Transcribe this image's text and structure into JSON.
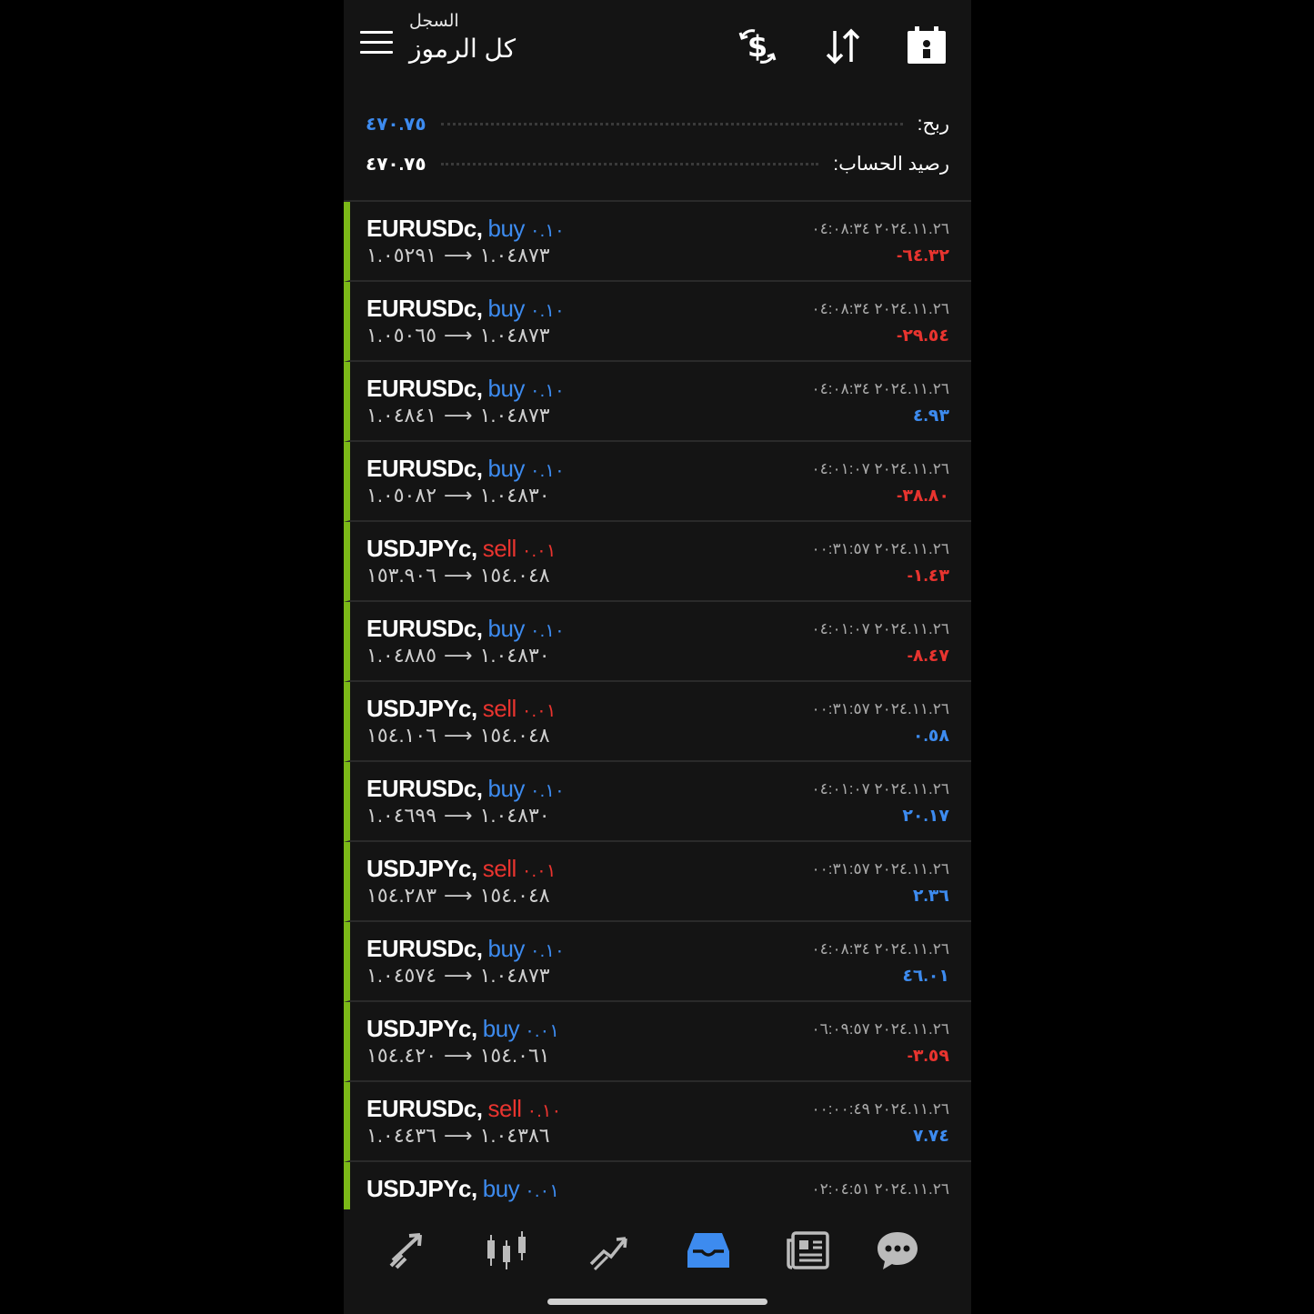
{
  "header": {
    "subtitle": "السجل",
    "title": "كل الرموز",
    "icons": [
      "menu-icon",
      "dollar-swap-icon",
      "sort-icon",
      "report-calendar-icon"
    ]
  },
  "summary": {
    "profit_label": "ربح:",
    "profit_value": "٤٧٠.٧٥",
    "balance_label": "رصيد الحساب:",
    "balance_value": "٤٧٠.٧٥"
  },
  "trades": [
    {
      "symbol": "EURUSDc,",
      "side": "buy",
      "volume": "٠.١٠",
      "open": "١.٠٤٨٧٣",
      "close": "١.٠٥٢٩١",
      "time": "٢٠٢٤.١١.٢٦ ٠٤:٠٨:٣٤",
      "profit": "-٦٤.٣٢",
      "profit_sign": "neg"
    },
    {
      "symbol": "EURUSDc,",
      "side": "buy",
      "volume": "٠.١٠",
      "open": "١.٠٤٨٧٣",
      "close": "١.٠٥٠٦٥",
      "time": "٢٠٢٤.١١.٢٦ ٠٤:٠٨:٣٤",
      "profit": "-٢٩.٥٤",
      "profit_sign": "neg"
    },
    {
      "symbol": "EURUSDc,",
      "side": "buy",
      "volume": "٠.١٠",
      "open": "١.٠٤٨٧٣",
      "close": "١.٠٤٨٤١",
      "time": "٢٠٢٤.١١.٢٦ ٠٤:٠٨:٣٤",
      "profit": "٤.٩٣",
      "profit_sign": "pos"
    },
    {
      "symbol": "EURUSDc,",
      "side": "buy",
      "volume": "٠.١٠",
      "open": "١.٠٤٨٣٠",
      "close": "١.٠٥٠٨٢",
      "time": "٢٠٢٤.١١.٢٦ ٠٤:٠١:٠٧",
      "profit": "-٣٨.٨٠",
      "profit_sign": "neg"
    },
    {
      "symbol": "USDJPYc,",
      "side": "sell",
      "volume": "٠.٠١",
      "open": "١٥٤.٠٤٨",
      "close": "١٥٣.٩٠٦",
      "time": "٢٠٢٤.١١.٢٦ ٠٠:٣١:٥٧",
      "profit": "-١.٤٣",
      "profit_sign": "neg"
    },
    {
      "symbol": "EURUSDc,",
      "side": "buy",
      "volume": "٠.١٠",
      "open": "١.٠٤٨٣٠",
      "close": "١.٠٤٨٨٥",
      "time": "٢٠٢٤.١١.٢٦ ٠٤:٠١:٠٧",
      "profit": "-٨.٤٧",
      "profit_sign": "neg"
    },
    {
      "symbol": "USDJPYc,",
      "side": "sell",
      "volume": "٠.٠١",
      "open": "١٥٤.٠٤٨",
      "close": "١٥٤.١٠٦",
      "time": "٢٠٢٤.١١.٢٦ ٠٠:٣١:٥٧",
      "profit": "٠.٥٨",
      "profit_sign": "pos"
    },
    {
      "symbol": "EURUSDc,",
      "side": "buy",
      "volume": "٠.١٠",
      "open": "١.٠٤٨٣٠",
      "close": "١.٠٤٦٩٩",
      "time": "٢٠٢٤.١١.٢٦ ٠٤:٠١:٠٧",
      "profit": "٢٠.١٧",
      "profit_sign": "pos"
    },
    {
      "symbol": "USDJPYc,",
      "side": "sell",
      "volume": "٠.٠١",
      "open": "١٥٤.٠٤٨",
      "close": "١٥٤.٢٨٣",
      "time": "٢٠٢٤.١١.٢٦ ٠٠:٣١:٥٧",
      "profit": "٢.٣٦",
      "profit_sign": "pos"
    },
    {
      "symbol": "EURUSDc,",
      "side": "buy",
      "volume": "٠.١٠",
      "open": "١.٠٤٨٧٣",
      "close": "١.٠٤٥٧٤",
      "time": "٢٠٢٤.١١.٢٦ ٠٤:٠٨:٣٤",
      "profit": "٤٦.٠١",
      "profit_sign": "pos"
    },
    {
      "symbol": "USDJPYc,",
      "side": "buy",
      "volume": "٠.٠١",
      "open": "١٥٤.٠٦١",
      "close": "١٥٤.٤٢٠",
      "time": "٢٠٢٤.١١.٢٦ ٠٦:٠٩:٥٧",
      "profit": "-٣.٥٩",
      "profit_sign": "neg"
    },
    {
      "symbol": "EURUSDc,",
      "side": "sell",
      "volume": "٠.١٠",
      "open": "١.٠٤٣٨٦",
      "close": "١.٠٤٤٣٦",
      "time": "٢٠٢٤.١١.٢٦ ٠٠:٠٠:٤٩",
      "profit": "٧.٧٤",
      "profit_sign": "pos"
    },
    {
      "symbol": "USDJPYc,",
      "side": "buy",
      "volume": "٠.٠١",
      "open": "",
      "close": "",
      "time": "٢٠٢٤.١١.٢٦ ٠٢:٠٤:٥١",
      "profit": "",
      "profit_sign": "neg"
    }
  ],
  "bottom_nav": {
    "items": [
      "quotes-icon",
      "chart-icon",
      "trade-icon",
      "history-icon",
      "news-icon",
      "chat-icon"
    ],
    "active": "history-icon"
  },
  "colors": {
    "accent_blue": "#3d8bef",
    "loss_red": "#e8342f",
    "row_marker_green": "#7bb818",
    "background": "#141414"
  }
}
